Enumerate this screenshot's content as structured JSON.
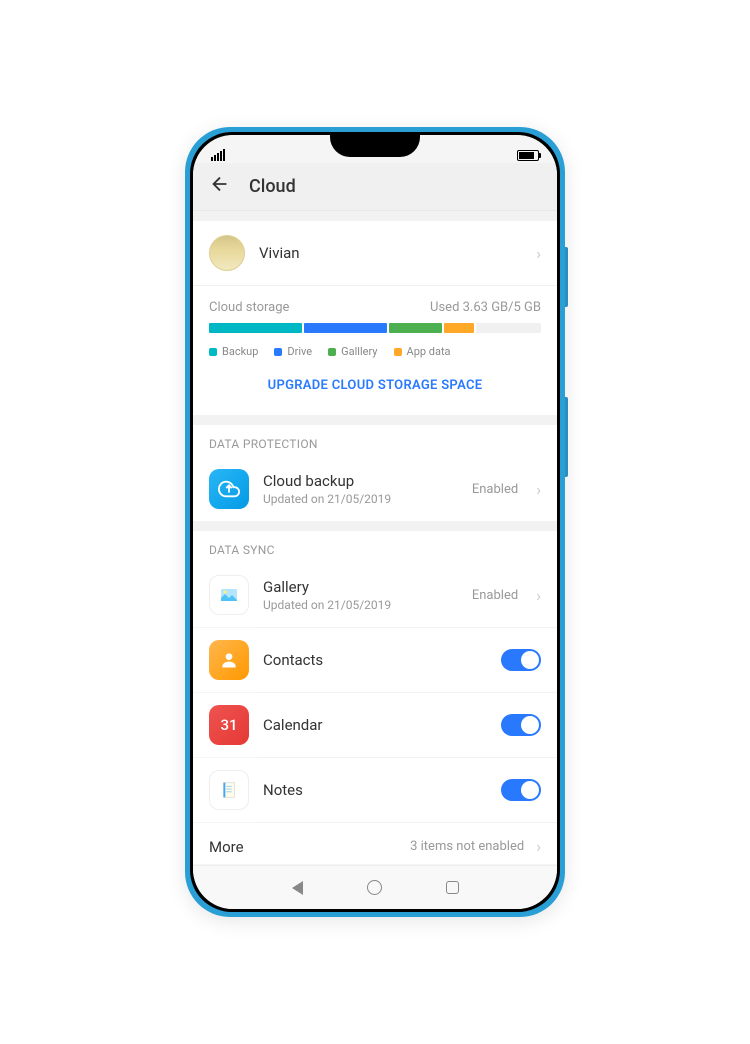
{
  "header": {
    "title": "Cloud"
  },
  "profile": {
    "name": "Vivian"
  },
  "storage": {
    "label": "Cloud storage",
    "used_text": "Used 3.63 GB/5 GB",
    "legend": {
      "backup": "Backup",
      "drive": "Drive",
      "gallery": "Galllery",
      "appdata": "App data"
    },
    "upgrade_cta": "UPGRADE CLOUD STORAGE SPACE"
  },
  "sections": {
    "data_protection": {
      "title": "DATA PROTECTION",
      "cloud_backup": {
        "title": "Cloud backup",
        "subtitle": "Updated on 21/05/2019",
        "status": "Enabled"
      }
    },
    "data_sync": {
      "title": "DATA SYNC",
      "gallery": {
        "title": "Gallery",
        "subtitle": "Updated on 21/05/2019",
        "status": "Enabled"
      },
      "contacts": {
        "title": "Contacts"
      },
      "calendar": {
        "title": "Calendar",
        "day": "31"
      },
      "notes": {
        "title": "Notes"
      }
    }
  },
  "more": {
    "label": "More",
    "status": "3 items not enabled"
  }
}
